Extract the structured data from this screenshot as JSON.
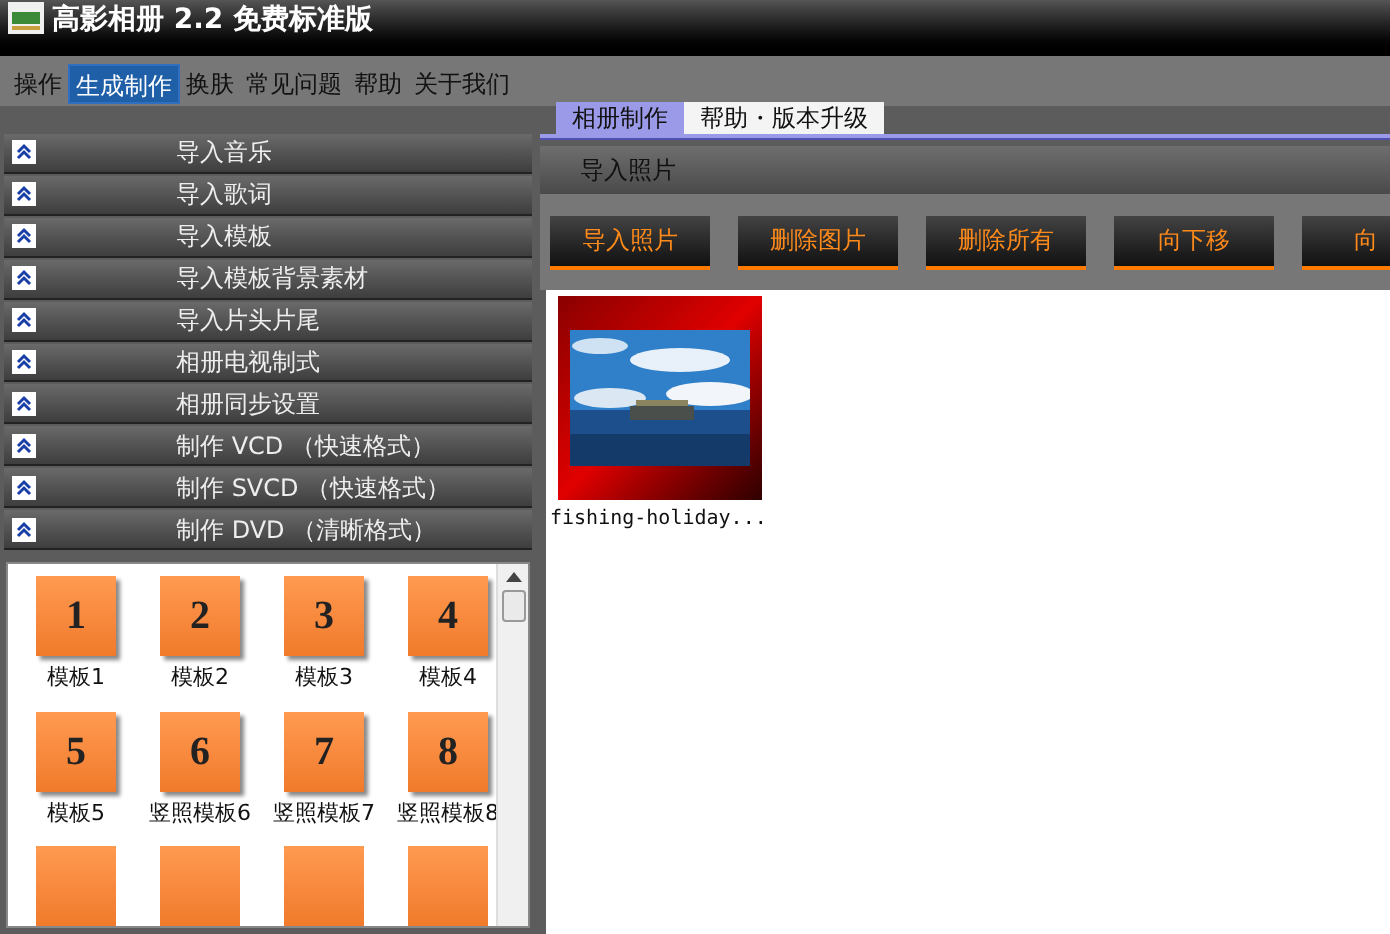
{
  "window": {
    "title": "高影相册 2.2 免费标准版"
  },
  "menu": [
    {
      "label": "操作",
      "selected": false
    },
    {
      "label": "生成制作",
      "selected": true
    },
    {
      "label": "换肤",
      "selected": false
    },
    {
      "label": "常见问题",
      "selected": false
    },
    {
      "label": "帮助",
      "selected": false
    },
    {
      "label": "关于我们",
      "selected": false
    }
  ],
  "sidebar": {
    "items": [
      {
        "label": "导入音乐"
      },
      {
        "label": "导入歌词"
      },
      {
        "label": "导入模板"
      },
      {
        "label": "导入模板背景素材"
      },
      {
        "label": "导入片头片尾"
      },
      {
        "label": "相册电视制式"
      },
      {
        "label": "相册同步设置"
      },
      {
        "label": "制作 VCD （快速格式）"
      },
      {
        "label": "制作 SVCD （快速格式）"
      },
      {
        "label": "制作 DVD （清晰格式）"
      }
    ]
  },
  "templates": [
    {
      "number": "1",
      "label": "模板1"
    },
    {
      "number": "2",
      "label": "模板2"
    },
    {
      "number": "3",
      "label": "模板3"
    },
    {
      "number": "4",
      "label": "模板4"
    },
    {
      "number": "5",
      "label": "模板5"
    },
    {
      "number": "6",
      "label": "竖照模板6"
    },
    {
      "number": "7",
      "label": "竖照模板7"
    },
    {
      "number": "8",
      "label": "竖照模板8"
    }
  ],
  "tabs": [
    {
      "label": "相册制作",
      "selected": true
    },
    {
      "label": "帮助・版本升级",
      "selected": false
    }
  ],
  "section_title": "导入照片",
  "buttons": [
    "导入照片",
    "删除图片",
    "删除所有",
    "向下移",
    "向"
  ],
  "photos": [
    {
      "kind": "picture",
      "caption": "fishing-holiday..."
    }
  ]
}
